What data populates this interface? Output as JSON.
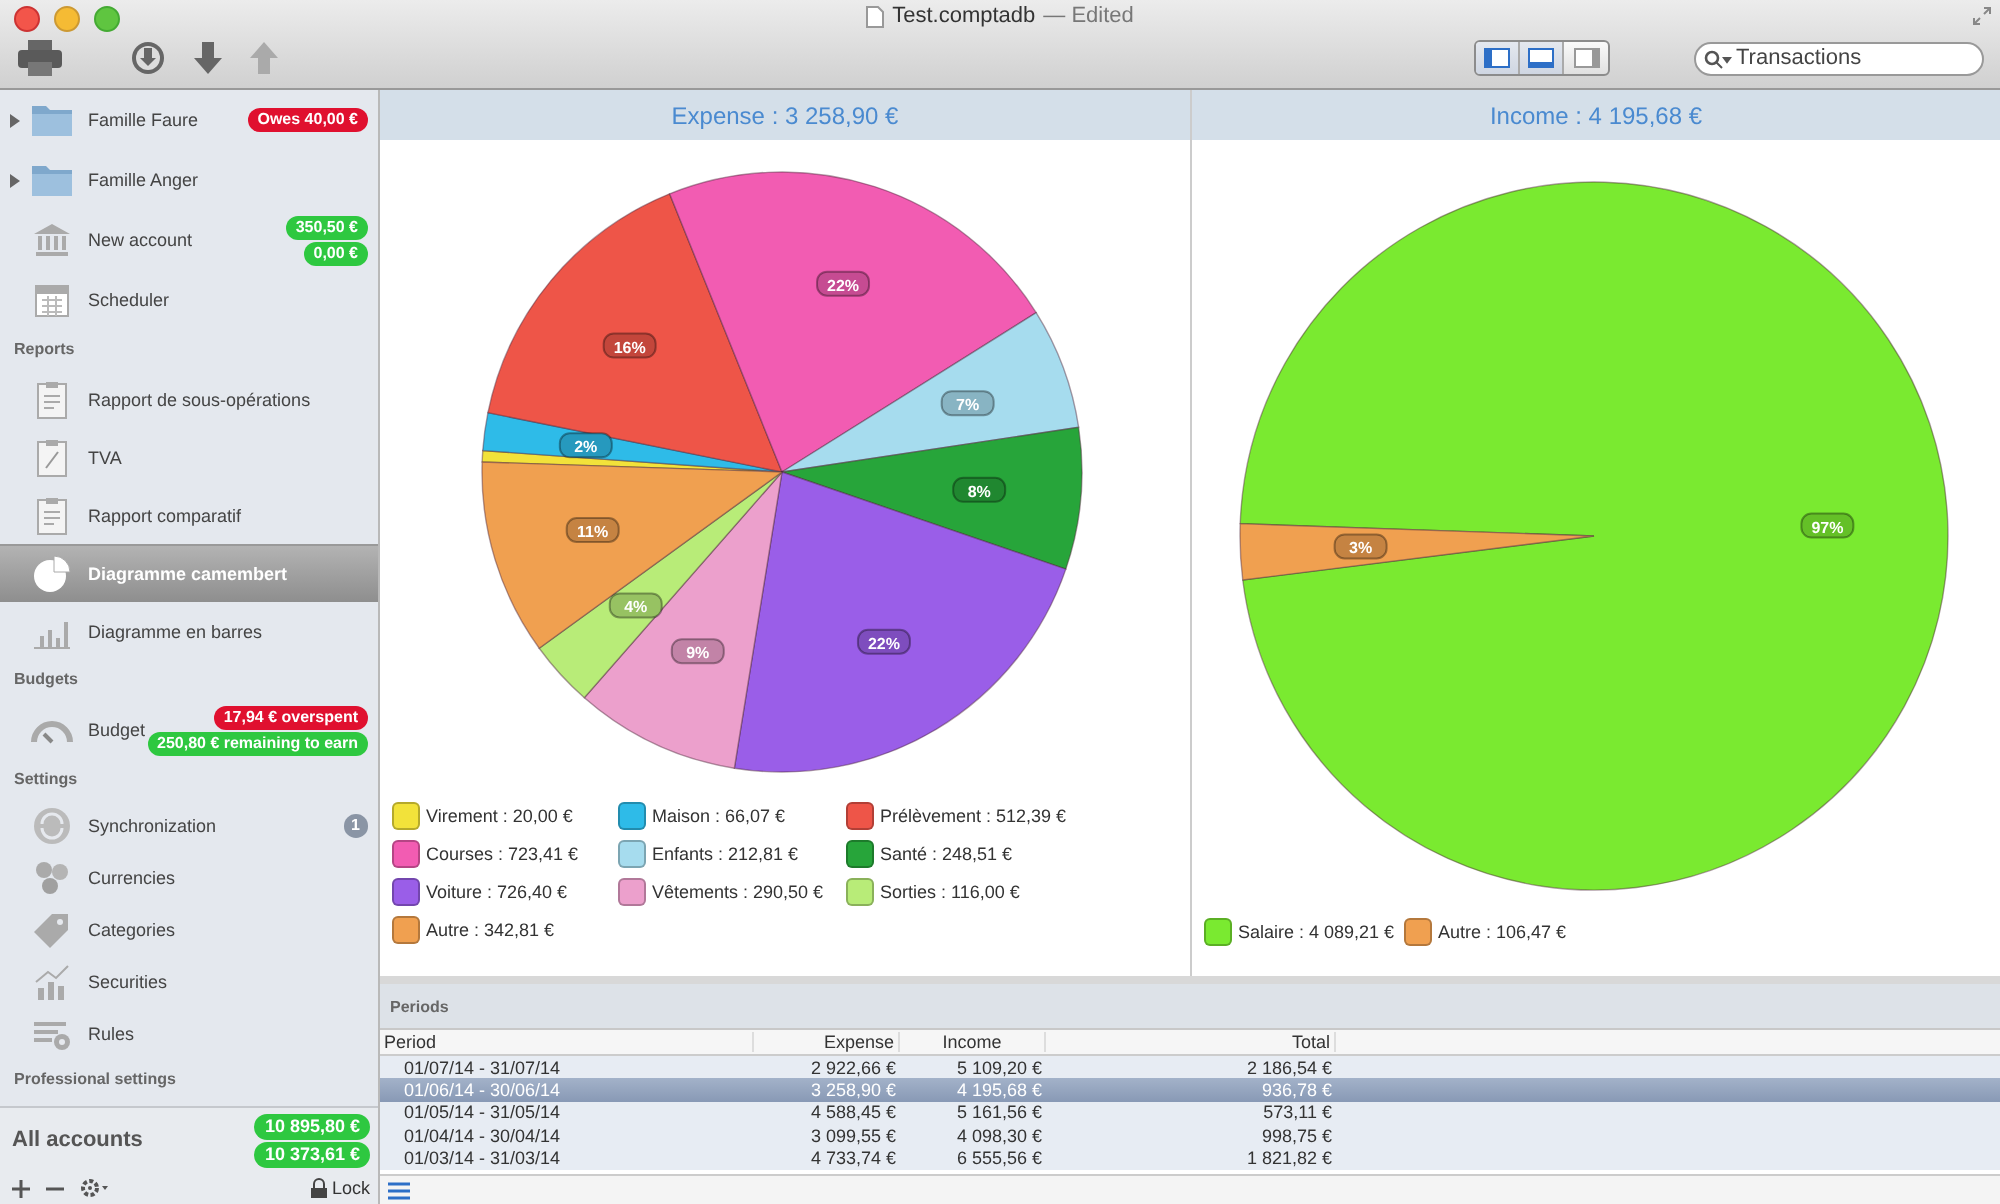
{
  "window": {
    "title": "Test.comptadb",
    "status": "— Edited"
  },
  "toolbar": {
    "view_buttons": [
      {
        "selected": true
      },
      {
        "selected": true
      },
      {
        "selected": false
      }
    ],
    "search": {
      "placeholder": "Transactions"
    }
  },
  "sidebar": {
    "sections": [
      {
        "items": [
          {
            "kind": "folder",
            "label": "Famille Faure",
            "expanded": false,
            "selected": false,
            "badges": [
              {
                "text": "Owes 40,00 €",
                "color": "#e0102f"
              }
            ]
          },
          {
            "kind": "folder",
            "label": "Famille Anger",
            "expanded": false,
            "selected": false
          },
          {
            "kind": "item",
            "label": "New account",
            "selected": false,
            "badges": [
              {
                "text": "350,50 €",
                "color": "#2ec840"
              },
              {
                "text": "0,00 €",
                "color": "#2ec840"
              }
            ]
          },
          {
            "kind": "item",
            "label": "Scheduler",
            "selected": false
          }
        ]
      },
      {
        "title": "Reports",
        "items": [
          {
            "kind": "item",
            "label": "Rapport de sous-opérations",
            "selected": false
          },
          {
            "kind": "item",
            "label": "TVA",
            "selected": false
          },
          {
            "kind": "item",
            "label": "Rapport comparatif",
            "selected": false
          },
          {
            "kind": "item",
            "label": "Diagramme camembert",
            "selected": true
          },
          {
            "kind": "item",
            "label": "Diagramme en barres",
            "selected": false
          }
        ]
      },
      {
        "title": "Budgets",
        "items": [
          {
            "kind": "item",
            "label": "Budget",
            "selected": false,
            "badges": [
              {
                "text": "17,94 € overspent",
                "color": "#e0102f"
              },
              {
                "text": "250,80 € remaining to earn",
                "color": "#2ec840"
              }
            ]
          }
        ]
      },
      {
        "title": "Settings",
        "items": [
          {
            "kind": "item",
            "label": "Synchronization",
            "selected": false,
            "badges": [
              {
                "text": "1",
                "color": "#8a95a5"
              }
            ]
          },
          {
            "kind": "item",
            "label": "Currencies",
            "selected": false
          },
          {
            "kind": "item",
            "label": "Categories",
            "selected": false
          },
          {
            "kind": "item",
            "label": "Securities",
            "selected": false
          },
          {
            "kind": "item",
            "label": "Rules",
            "selected": false
          }
        ]
      },
      {
        "title": "Professional settings"
      }
    ],
    "footer": {
      "label": "All accounts",
      "badges": [
        {
          "text": "10 895,80 €",
          "color": "#2ec840"
        },
        {
          "text": "10 373,61 €",
          "color": "#2ec840"
        }
      ],
      "lock": "Lock"
    }
  },
  "panes": [
    {
      "title": "Expense : 3 258,90 €",
      "legend": [
        {
          "label": "Virement : 20,00 €",
          "color": "#f2e23a"
        },
        {
          "label": "Maison : 66,07 €",
          "color": "#2ebbe8"
        },
        {
          "label": "Prélèvement : 512,39 €",
          "color": "#ee5548"
        },
        {
          "label": "Courses : 723,41 €",
          "color": "#f25cb2"
        },
        {
          "label": "Enfants : 212,81 €",
          "color": "#a6dcee"
        },
        {
          "label": "Santé : 248,51 €",
          "color": "#27a53a"
        },
        {
          "label": "Voiture : 726,40 €",
          "color": "#9a5ee8"
        },
        {
          "label": "Vêtements : 290,50 €",
          "color": "#eca0cc"
        },
        {
          "label": "Sorties : 116,00 €",
          "color": "#b8ec78"
        },
        {
          "label": "Autre : 342,81 €",
          "color": "#f0a050"
        }
      ],
      "chart_data": {
        "type": "pie",
        "values": [
          0.61,
          2.03,
          15.72,
          22.2,
          6.53,
          7.63,
          22.29,
          8.91,
          3.56,
          10.52
        ],
        "value_labels": [
          null,
          "2%",
          "16%",
          "22%",
          "7%",
          "8%",
          "22%",
          "9%",
          "4%",
          "11%"
        ]
      }
    },
    {
      "title": "Income : 4 195,68 €",
      "legend": [
        {
          "label": "Salaire : 4 089,21 €",
          "color": "#7aea30"
        },
        {
          "label": "Autre : 106,47 €",
          "color": "#f0a050"
        }
      ],
      "chart_data": {
        "type": "pie",
        "values": [
          97.46,
          2.54
        ],
        "value_labels": [
          "97%",
          "3%"
        ]
      }
    }
  ],
  "periods": {
    "title": "Periods",
    "columns": [
      "Period",
      "Expense",
      "Income",
      "Total"
    ],
    "rows": [
      {
        "cells": [
          "01/07/14 - 31/07/14",
          "2 922,66 €",
          "5 109,20 €",
          "2 186,54 €"
        ],
        "selected": false
      },
      {
        "cells": [
          "01/06/14 - 30/06/14",
          "3 258,90 €",
          "4 195,68 €",
          "936,78 €"
        ],
        "selected": true
      },
      {
        "cells": [
          "01/05/14 - 31/05/14",
          "4 588,45 €",
          "5 161,56 €",
          "573,11 €"
        ],
        "selected": false
      },
      {
        "cells": [
          "01/04/14 - 30/04/14",
          "3 099,55 €",
          "4 098,30 €",
          "998,75 €"
        ],
        "selected": false
      },
      {
        "cells": [
          "01/03/14 - 31/03/14",
          "4 733,74 €",
          "6 555,56 €",
          "1 821,82 €"
        ],
        "selected": false
      }
    ]
  }
}
